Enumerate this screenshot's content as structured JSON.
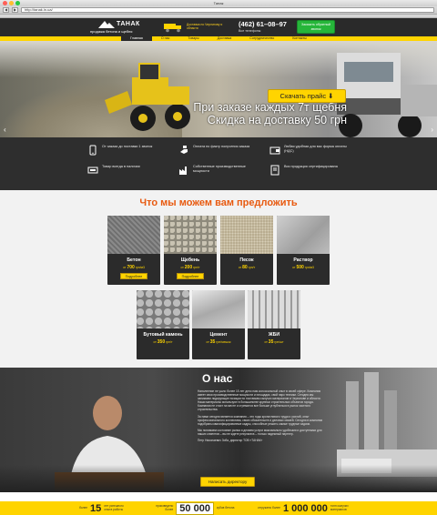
{
  "browser": {
    "title": "Танак",
    "url": "http://tanak.in.ua/",
    "back": "◀",
    "forward": "▶"
  },
  "header": {
    "brand": "ТАНАК",
    "tagline": "продажа бетона и щебня",
    "delivery": "Доставка по Чернигову и области",
    "phone": "(462) 61–08–97",
    "phone_sub": "Все телефоны",
    "call_button": "Заказать обратный звонок"
  },
  "nav": {
    "items": [
      "Главная",
      "О нас",
      "Товары",
      "Доставка",
      "Сотрудничество",
      "Контакты"
    ]
  },
  "hero": {
    "line1": "При заказе каждых 7т щебня",
    "line2": "Скидка на доставку 50 грн",
    "price_button": "Скачать прайс ⬇"
  },
  "features": [
    {
      "icon": "phone-icon",
      "text": "От заказа до поставки 1 звонок"
    },
    {
      "icon": "hand-icon",
      "text": "Оплата по факту получения заказа"
    },
    {
      "icon": "wallet-icon",
      "text": "Любая удобная для вас форма оплаты (НДС)"
    },
    {
      "icon": "truck-icon",
      "text": "Товар всегда в наличии"
    },
    {
      "icon": "factory-icon",
      "text": "Собственные производственные мощности"
    },
    {
      "icon": "certificate-icon",
      "text": "Вся продукция сертифицирована"
    }
  ],
  "offers": {
    "title": "Что мы можем вам предложить",
    "products": [
      {
        "name": "Бетон",
        "from": "от",
        "price": "700",
        "unit": "грн/м3",
        "order": "Подробнее",
        "has_button": true
      },
      {
        "name": "Щебень",
        "from": "от",
        "price": "200",
        "unit": "грн/т",
        "order": "Подробнее",
        "has_button": true
      },
      {
        "name": "Песок",
        "from": "от",
        "price": "80",
        "unit": "грн/т",
        "order": "",
        "has_button": false
      },
      {
        "name": "Раствор",
        "from": "от",
        "price": "500",
        "unit": "грн/м3",
        "order": "",
        "has_button": false
      },
      {
        "name": "Бутовый камень",
        "from": "от",
        "price": "350",
        "unit": "грн/т",
        "order": "",
        "has_button": false
      },
      {
        "name": "Цемент",
        "from": "от",
        "price": "35",
        "unit": "грн/мешок",
        "order": "",
        "has_button": false
      },
      {
        "name": "ЖБИ",
        "from": "от",
        "price": "35",
        "unit": "грн/шт",
        "order": "",
        "has_button": false
      }
    ]
  },
  "about": {
    "title": "О нас",
    "p1": "Наполнение не ушло более 15 лет дело нам колоссальный опыт в своей сфере. Компания имеет свои производственные мощности и площадки, свой парк техники. Сегодня мы занимаем лидирующие позиции по поставкам сыпучих материалов в Чернигове и области. Наши материалы используют в большинстве крупных строительных объектов города. Компания не стоит на месте и стремится все больше углубляться в рынок частного строительства.",
    "p2": "За нами сегодня является компания – это годы кропотливого труда и усилий, опыт профессионального коллектива, своих обязательств и деловых связей. Сегодня в компании подобраны квалифицированные кадры, способные решить самые трудные задачи.",
    "p3": "Мы понимаем состояние рынка и делаем услуги максимально удобными и доступными для наших клиентов – вы не ждете результата – только надежный партнер.",
    "sign": "Петр Николаевич Зоба, директор ТОВ «ТАНАК»",
    "button": "Написать директору"
  },
  "stats": [
    {
      "label": "более",
      "value": "15",
      "text": "лет успешного опыта работы",
      "boxed": false
    },
    {
      "label": "произведено более",
      "value": "50 000",
      "text": "кубов бетона",
      "boxed": true
    },
    {
      "label": "отгружено более",
      "value": "1 000 000",
      "text": "тонн сыпучих материалов",
      "boxed": false
    }
  ],
  "colors": {
    "accent": "#ffd400",
    "dark": "#2a2a2a",
    "orange": "#e85a10",
    "green": "#26b63a"
  }
}
